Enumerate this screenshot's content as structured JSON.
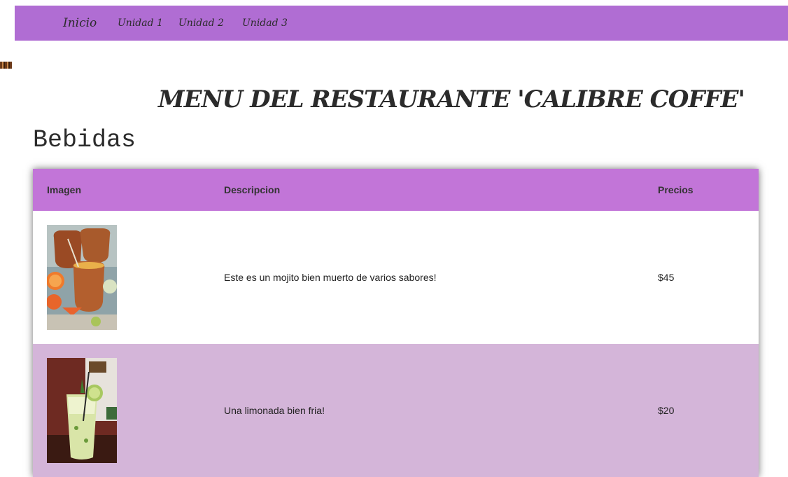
{
  "nav": {
    "home": "Inicio",
    "unit1": "Unidad 1",
    "unit2": "Unidad 2",
    "unit3": "Unidad 3"
  },
  "page_title": "MENU DEL RESTAURANTE 'CALIBRE COFFE'",
  "section_title": "Bebidas",
  "table": {
    "headers": [
      "Imagen",
      "Descripcion",
      "Precios"
    ],
    "rows": [
      {
        "image": "cantarito-drink-image",
        "description": "Este es un mojito bien muerto de varios sabores!",
        "price": "$45"
      },
      {
        "image": "lemonade-glass-image",
        "description": "Una limonada bien fria!",
        "price": "$20"
      }
    ]
  },
  "colors": {
    "navbar": "#b06dd3",
    "table_header": "#c275d8",
    "alt_row": "#d4b5d9"
  }
}
